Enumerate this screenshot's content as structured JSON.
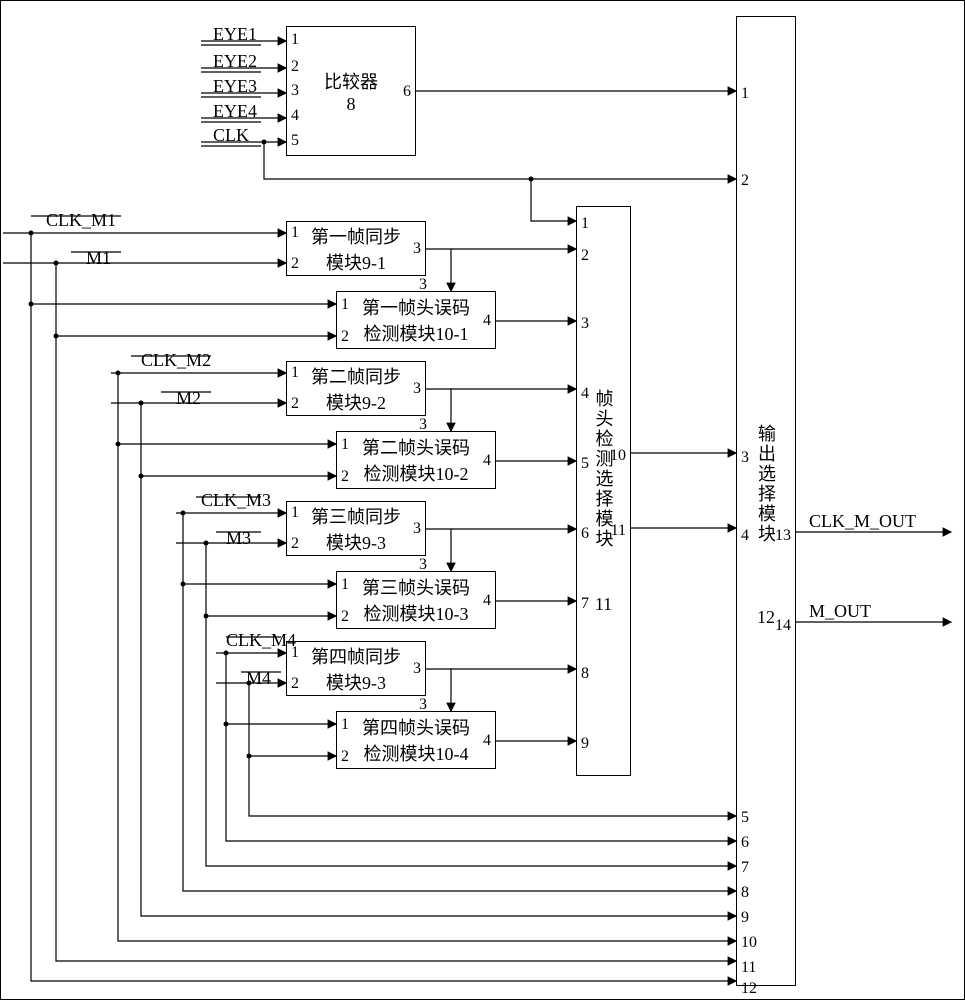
{
  "inputs": {
    "eye1": "EYE1",
    "eye2": "EYE2",
    "eye3": "EYE3",
    "eye4": "EYE4",
    "clk": "CLK",
    "clk_m1": "CLK_M1",
    "m1": "M1",
    "clk_m2": "CLK_M2",
    "m2": "M2",
    "clk_m3": "CLK_M3",
    "m3": "M3",
    "clk_m4": "CLK_M4",
    "m4": "M4"
  },
  "outputs": {
    "clk_m_out": "CLK_M_OUT",
    "m_out": "M_OUT"
  },
  "blocks": {
    "comparator": {
      "title": "比较器",
      "id": "8"
    },
    "sync1": {
      "title": "第一帧同步",
      "sub": "模块9-1"
    },
    "err1": {
      "title": "第一帧头误码",
      "sub": "检测模块10-1"
    },
    "sync2": {
      "title": "第二帧同步",
      "sub": "模块9-2"
    },
    "err2": {
      "title": "第二帧头误码",
      "sub": "检测模块10-2"
    },
    "sync3": {
      "title": "第三帧同步",
      "sub": "模块9-3"
    },
    "err3": {
      "title": "第三帧头误码",
      "sub": "检测模块10-3"
    },
    "sync4": {
      "title": "第四帧同步",
      "sub": "模块9-3"
    },
    "err4": {
      "title": "第四帧头误码",
      "sub": "检测模块10-4"
    },
    "select": {
      "title": "帧头检测选择模块",
      "id": "11"
    },
    "output": {
      "title": "输出选择模块",
      "id": "12"
    }
  },
  "pins": {
    "p1": "1",
    "p2": "2",
    "p3": "3",
    "p4": "4",
    "p5": "5",
    "p6": "6",
    "p7": "7",
    "p8": "8",
    "p9": "9",
    "p10": "10",
    "p11": "11",
    "p12": "12",
    "p13": "13",
    "p14": "14"
  }
}
